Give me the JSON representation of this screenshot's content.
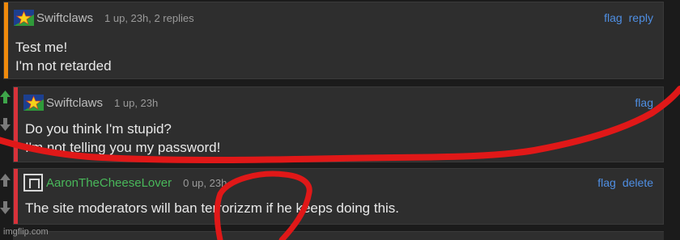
{
  "colors": {
    "background": "#1b1b1b",
    "card": "#2e2e2e",
    "link": "#4f8fe3",
    "username_swiftclaws": "#bdbdbd",
    "username_aaron": "#49b85a",
    "accent_orange": "#f08a0c",
    "accent_red": "#d8323a",
    "upvote_active": "#3ea54a",
    "vote_inactive": "#7a7a7a",
    "annotation_red": "#e01818"
  },
  "comments": [
    {
      "username": "Swiftclaws",
      "meta": "1 up, 23h, 2 replies",
      "actions": [
        "flag",
        "reply"
      ],
      "lines": [
        "Test me!",
        "I'm not retarded"
      ],
      "avatar": "star-avatar-icon"
    },
    {
      "username": "Swiftclaws",
      "meta": "1 up, 23h",
      "actions": [
        "flag"
      ],
      "lines": [
        "Do you think I'm stupid?",
        "I'm not telling you my password!"
      ],
      "avatar": "star-avatar-icon",
      "upvoted": true
    },
    {
      "username": "AaronTheCheeseLover",
      "meta": "0 up, 23h",
      "actions": [
        "flag",
        "delete"
      ],
      "lines": [
        "The site moderators will ban terrorizzm if he keeps doing this."
      ],
      "avatar": "default-user-icon"
    }
  ],
  "watermark": "imgflip.com"
}
